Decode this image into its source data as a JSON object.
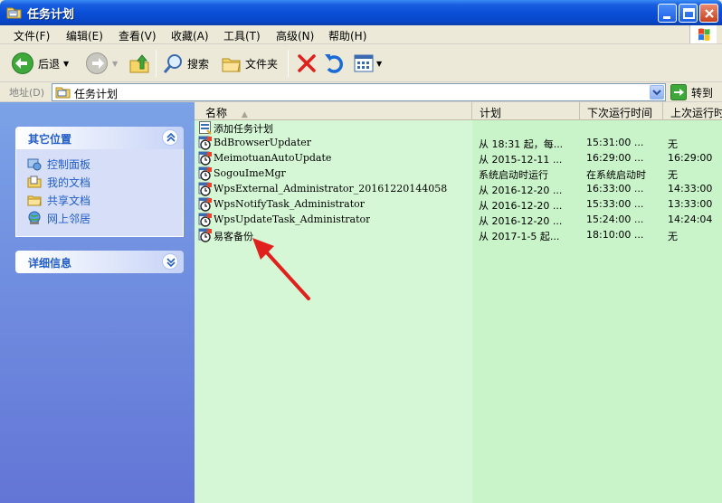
{
  "window": {
    "title": "任务计划"
  },
  "menu": [
    "文件(F)",
    "编辑(E)",
    "查看(V)",
    "收藏(A)",
    "工具(T)",
    "高级(N)",
    "帮助(H)"
  ],
  "toolbar": {
    "back": "后退",
    "search": "搜索",
    "folders": "文件夹"
  },
  "address": {
    "label": "地址(D)",
    "value": "任务计划",
    "go": "转到"
  },
  "sidebar": {
    "other_places": {
      "title": "其它位置",
      "links": [
        "控制面板",
        "我的文档",
        "共享文档",
        "网上邻居"
      ]
    },
    "details": {
      "title": "详细信息"
    }
  },
  "columns": [
    "名称",
    "计划",
    "下次运行时间",
    "上次运行时"
  ],
  "rows": [
    {
      "name": "添加任务计划",
      "schedule": "",
      "next": "",
      "last": "",
      "icon": "add-task-icon"
    },
    {
      "name": "BdBrowserUpdater",
      "schedule": "从 18:31 起，每...",
      "next": "15:31:00  ...",
      "last": "无",
      "icon": "task-icon"
    },
    {
      "name": "MeimotuanAutoUpdate",
      "schedule": "从 2015-12-11 ...",
      "next": "16:29:00  ...",
      "last": "16:29:00",
      "icon": "task-icon"
    },
    {
      "name": "SogouImeMgr",
      "schedule": "系统启动时运行",
      "next": "在系统启动时",
      "last": "无",
      "icon": "task-icon"
    },
    {
      "name": "WpsExternal_Administrator_20161220144058",
      "schedule": "从 2016-12-20 ...",
      "next": "16:33:00  ...",
      "last": "14:33:00",
      "icon": "task-icon"
    },
    {
      "name": "WpsNotifyTask_Administrator",
      "schedule": "从 2016-12-20 ...",
      "next": "15:33:00  ...",
      "last": "13:33:00",
      "icon": "task-icon"
    },
    {
      "name": "WpsUpdateTask_Administrator",
      "schedule": "从 2016-12-20 ...",
      "next": "15:24:00  ...",
      "last": "14:24:04",
      "icon": "task-icon"
    },
    {
      "name": "易客备份",
      "schedule": "从 2017-1-5 起...",
      "next": "18:10:00  ...",
      "last": "无",
      "icon": "task-icon"
    }
  ],
  "colors": {
    "title_bar": "#0a4fd8",
    "sidebar": "#6e8fdf",
    "list_bg": "#d6f7d6",
    "link": "#215dc6",
    "arrow": "#e0201c"
  }
}
